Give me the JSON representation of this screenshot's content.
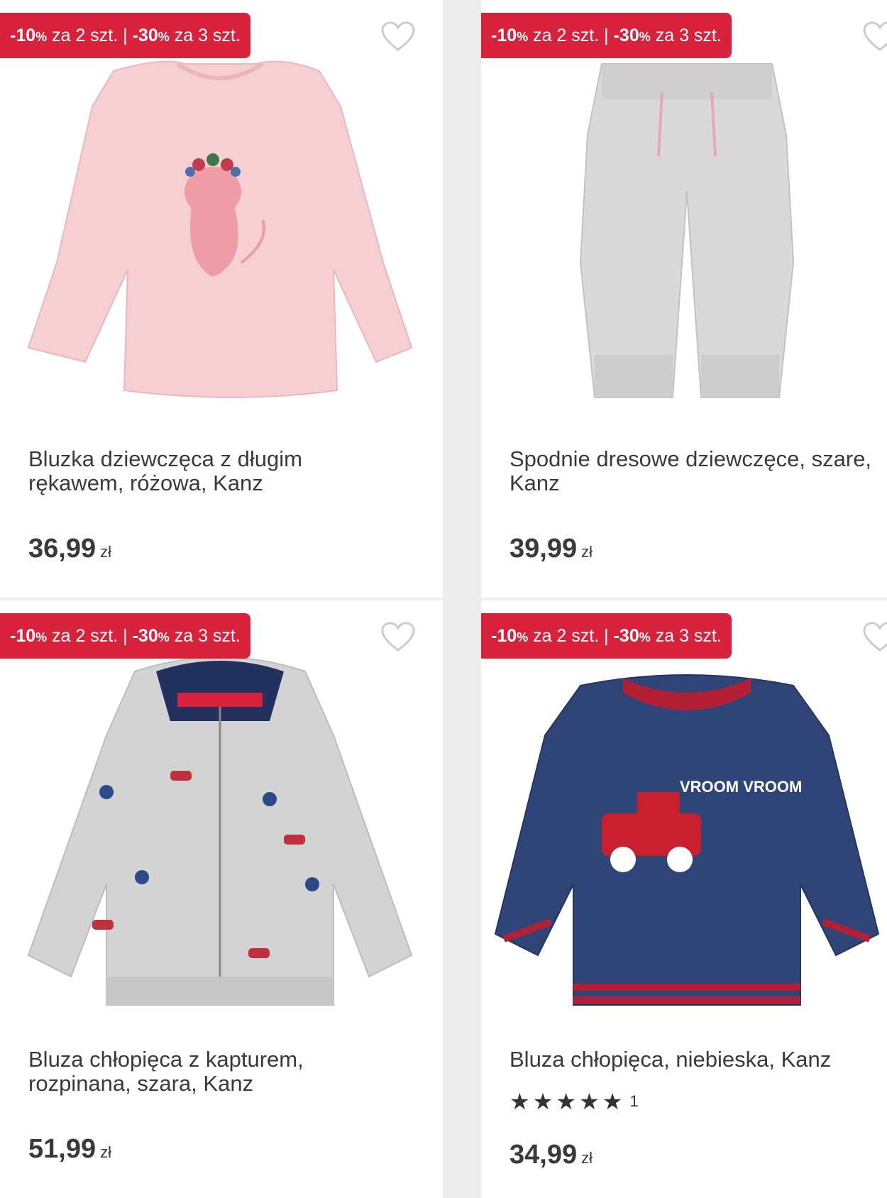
{
  "products": [
    {
      "promo": {
        "d1": "-10",
        "t1": "za 2 szt.",
        "sep": "|",
        "d2": "-30",
        "t2": "za 3 szt."
      },
      "title": "Bluzka dziewczęca z długim rękawem, różowa, Kanz",
      "price": "36,99",
      "currency": "zł",
      "image_icon": "pink-longsleeve-shirt-image"
    },
    {
      "promo": {
        "d1": "-10",
        "t1": "za 2 szt.",
        "sep": "|",
        "d2": "-30",
        "t2": "za 3 szt."
      },
      "title": "Spodnie dresowe dziewczęce, szare, Kanz",
      "price": "39,99",
      "currency": "zł",
      "image_icon": "grey-sweatpants-image"
    },
    {
      "promo": {
        "d1": "-10",
        "t1": "za 2 szt.",
        "sep": "|",
        "d2": "-30",
        "t2": "za 3 szt."
      },
      "title": "Bluza chłopięca z kapturem, rozpinana, szara, Kanz",
      "price": "51,99",
      "currency": "zł",
      "image_icon": "grey-hoodie-image"
    },
    {
      "promo": {
        "d1": "-10",
        "t1": "za 2 szt.",
        "sep": "|",
        "d2": "-30",
        "t2": "za 3 szt."
      },
      "title": "Bluza chłopięca, niebieska, Kanz",
      "rating": {
        "stars": 5,
        "count": "1"
      },
      "price": "34,99",
      "currency": "zł",
      "image_icon": "navy-sweatshirt-image",
      "print_text": "VROOM VROOM"
    }
  ],
  "pct_symbol": "%",
  "colors": {
    "promo": "#d8213b",
    "text": "#3a3a3a",
    "heart_outline": "#cccccc"
  }
}
